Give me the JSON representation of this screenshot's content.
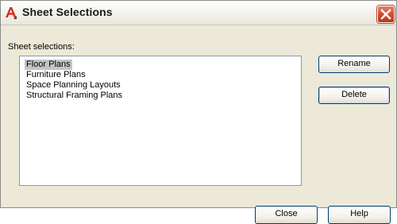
{
  "window": {
    "title": "Sheet Selections"
  },
  "section_label": "Sheet selections:",
  "sheets": [
    {
      "label": "Floor Plans",
      "selected": true
    },
    {
      "label": "Furniture Plans",
      "selected": false
    },
    {
      "label": "Space Planning Layouts",
      "selected": false
    },
    {
      "label": "Structural Framing Plans",
      "selected": false
    }
  ],
  "buttons": {
    "rename": "Rename",
    "delete": "Delete",
    "close": "Close",
    "help": "Help"
  },
  "icons": {
    "app": "autocad-a-icon",
    "close": "close-x-icon"
  },
  "colors": {
    "window_bg": "#ece9d8",
    "selection_bg": "#c4c4c4",
    "close_button": "#cf4a2b",
    "app_icon_red": "#d42b20"
  }
}
